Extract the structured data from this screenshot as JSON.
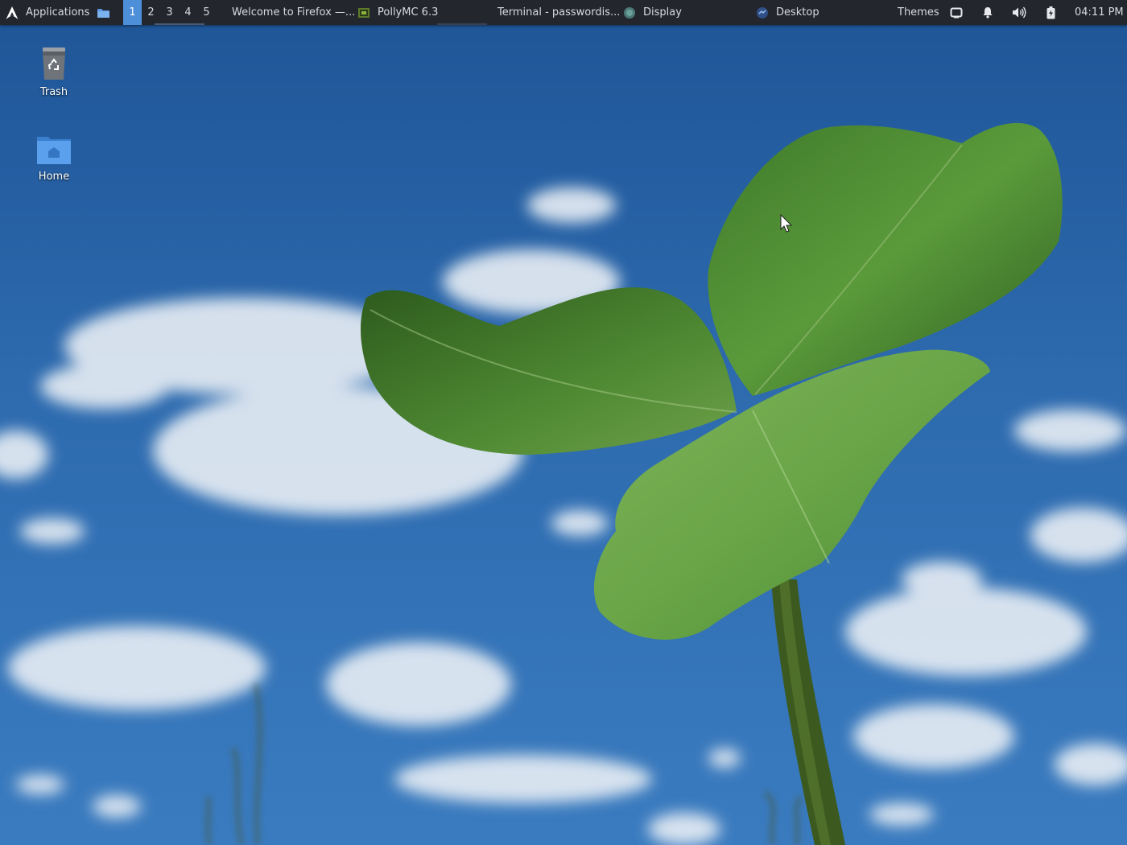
{
  "panel": {
    "applications_label": "Applications",
    "workspaces": [
      "1",
      "2",
      "3",
      "4",
      "5"
    ],
    "active_workspace": "1",
    "tasks": [
      {
        "label": "Welcome to Firefox —...",
        "icon": "firefox-icon"
      },
      {
        "label": "PollyMC 6.3",
        "icon": "pollymc-icon"
      },
      {
        "label": "Terminal - passwordis...",
        "icon": "terminal-icon"
      },
      {
        "label": "Display",
        "icon": "display-settings-icon"
      },
      {
        "label": "Desktop",
        "icon": "desktop-settings-icon"
      }
    ],
    "themes_label": "Themes",
    "clock": "04:11 PM",
    "colors": {
      "panel_bg": "#23262d",
      "active_workspace": "#4d8fd8"
    }
  },
  "desktop": {
    "icons": [
      {
        "label": "Trash",
        "icon": "trash-icon"
      },
      {
        "label": "Home",
        "icon": "home-folder-icon"
      }
    ],
    "wallpaper": "clover leaf against blue sky with clouds"
  }
}
